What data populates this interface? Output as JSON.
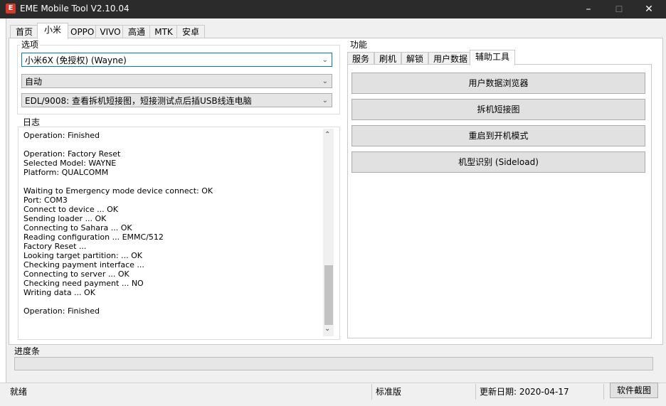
{
  "window": {
    "title": "EME Mobile Tool V2.10.04",
    "app_icon": "app-logo-icon",
    "controls": {
      "minimize": "–",
      "maximize": "☐",
      "close": "✕"
    }
  },
  "main_tabs": [
    "首页",
    "小米",
    "OPPO",
    "VIVO",
    "高通",
    "MTK",
    "安卓"
  ],
  "active_main_tab": "小米",
  "options": {
    "label": "选项",
    "model_select": "小米6X (免授权) (Wayne)",
    "mode_select": "自动",
    "method_select": "EDL/9008: 查看拆机短接图，短接测试点后插USB线连电脑"
  },
  "log": {
    "label": "日志",
    "lines": [
      "Operation: Finished",
      "",
      "Operation: Factory Reset",
      "Selected Model:  WAYNE",
      "Platform:  QUALCOMM",
      "",
      "Waiting to Emergency mode device connect: OK",
      "Port: COM3",
      "Connect to device ... OK",
      "Sending loader ... OK",
      "Connecting to Sahara ... OK",
      "Reading configuration ... EMMC/512",
      "Factory Reset ...",
      "Looking target partition: ... OK",
      "Checking payment interface ...",
      "Connecting to server ... OK",
      "Checking need payment ... NO",
      "Writing data ... OK",
      "",
      "Operation: Finished"
    ]
  },
  "functions": {
    "label": "功能",
    "tabs": [
      "服务",
      "刷机",
      "解锁",
      "用户数据",
      "辅助工具"
    ],
    "active_tab": "辅助工具",
    "buttons": [
      "用户数据浏览器",
      "拆机短接图",
      "重启到开机模式",
      "机型识别 (Sideload)"
    ]
  },
  "progress": {
    "label": "进度条",
    "value": 0
  },
  "status": {
    "state": "就绪",
    "edition": "标准版",
    "update_date": "更新日期: 2020-04-17",
    "screenshot_button": "软件截图"
  },
  "colors": {
    "titlebar": "#2b2b2b",
    "icon": "#d6392b",
    "focus": "#0078d7"
  }
}
